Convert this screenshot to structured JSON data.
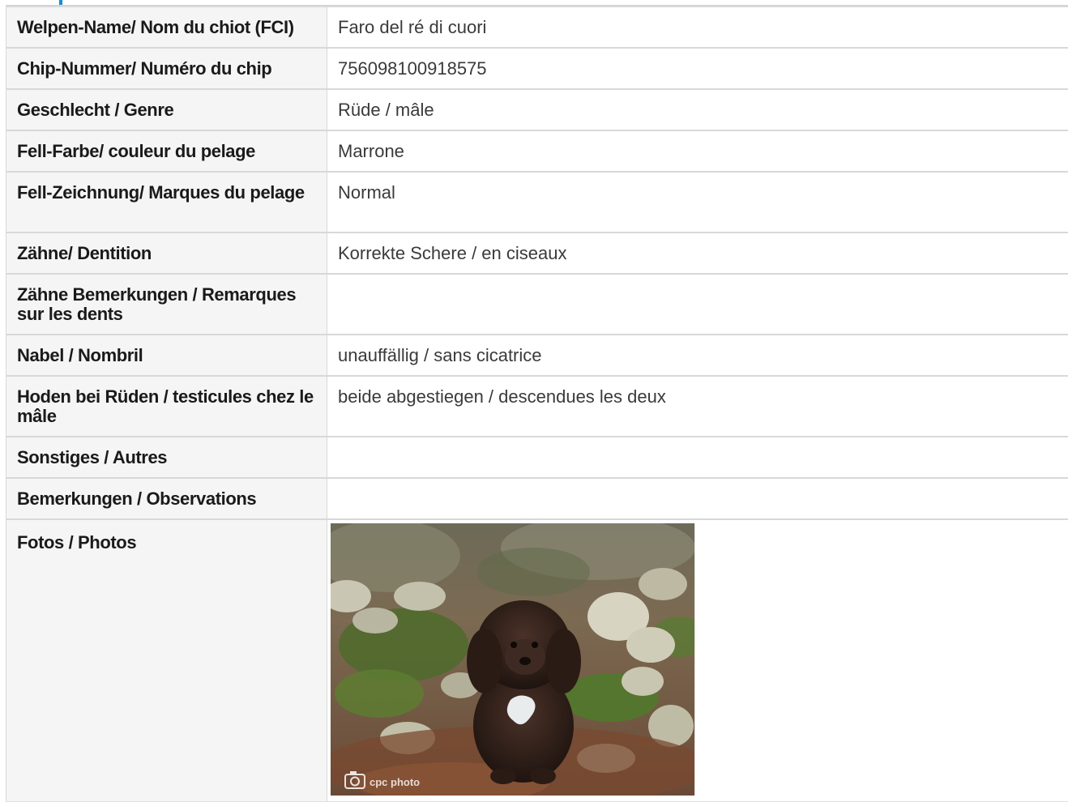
{
  "rows": [
    {
      "label": "Welpen-Name/ Nom du chiot (FCI)",
      "value": "Faro del ré di cuori"
    },
    {
      "label": "Chip-Nummer/ Numéro du chip",
      "value": "756098100918575"
    },
    {
      "label": "Geschlecht / Genre",
      "value": "Rüde / mâle"
    },
    {
      "label": "Fell-Farbe/ couleur du pelage",
      "value": "Marrone"
    },
    {
      "label": "Fell-Zeichnung/ Marques du pelage",
      "value": "Normal"
    },
    {
      "label": "Zähne/ Dentition",
      "value": "Korrekte Schere / en ciseaux"
    },
    {
      "label": "Zähne Bemerkungen / Remarques sur les dents",
      "value": ""
    },
    {
      "label": "Nabel / Nombril",
      "value": "unauffällig / sans cicatrice"
    },
    {
      "label": "Hoden bei Rüden / testicules chez le mâle",
      "value": "beide abgestiegen / descendues les deux"
    },
    {
      "label": "Sonstiges / Autres",
      "value": ""
    },
    {
      "label": "Bemerkungen / Observations",
      "value": ""
    },
    {
      "label": "Fotos / Photos",
      "value": ""
    }
  ],
  "photo": {
    "watermark": "cpc photo",
    "icon": "camera-icon",
    "subject": "dark brown curly puppy sitting on leaves and mossy rocks"
  },
  "colors": {
    "accent": "#1b8be0",
    "label_bg": "#f5f5f5",
    "border": "#d8d8d8"
  }
}
